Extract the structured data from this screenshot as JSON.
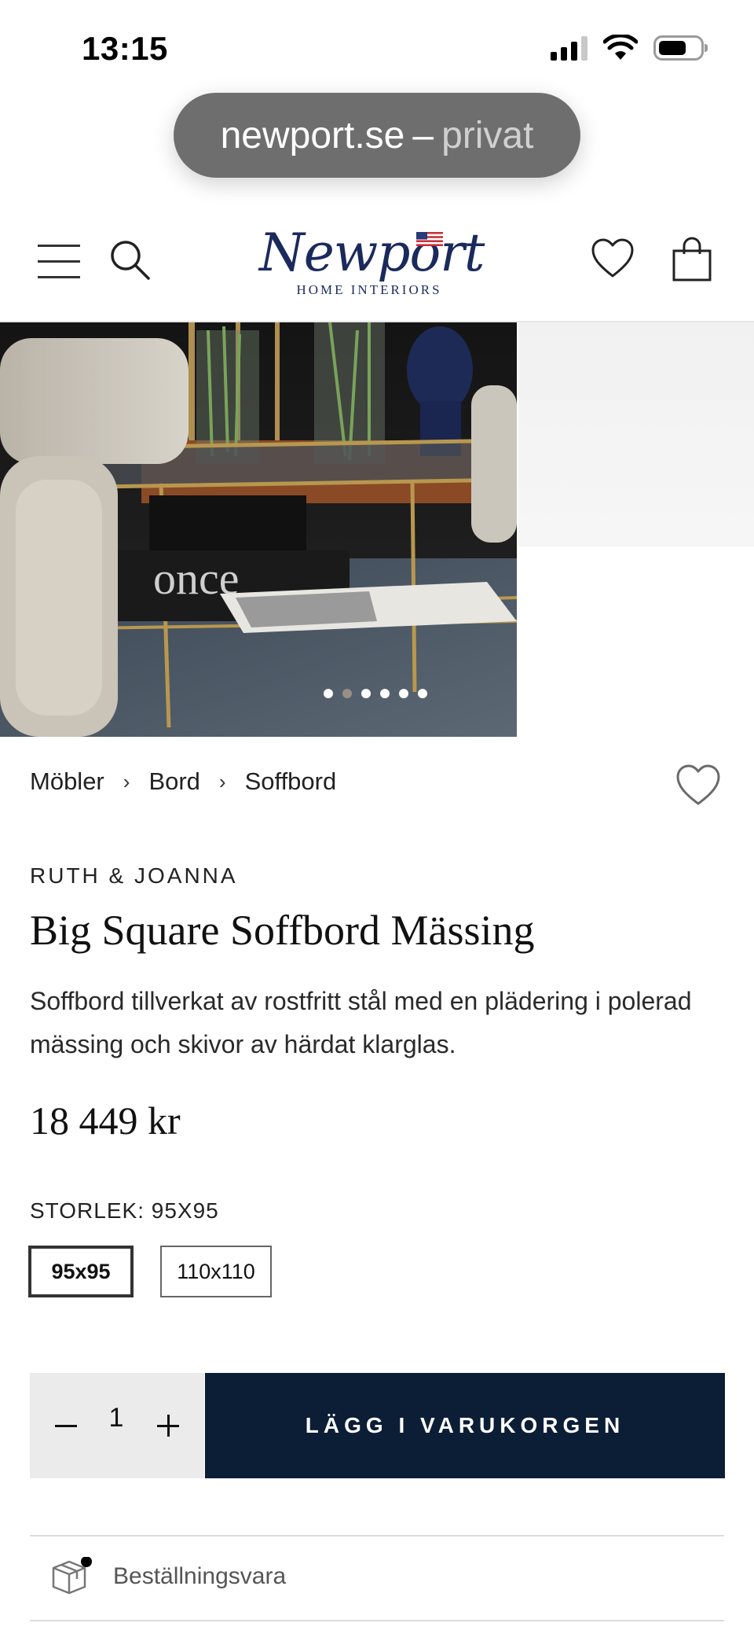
{
  "status_bar": {
    "time": "13:15"
  },
  "browser": {
    "domain": "newport.se",
    "separator": "–",
    "mode": "privat"
  },
  "header": {
    "logo_script": "Newport",
    "logo_sub": "HOME INTERIORS",
    "icons": [
      "menu-icon",
      "search-icon",
      "heart-icon",
      "shopping-bag-icon"
    ]
  },
  "gallery": {
    "dot_count": 6,
    "active_dot": 1
  },
  "breadcrumb": {
    "items": [
      "Möbler",
      "Bord",
      "Soffbord"
    ],
    "separator": "›"
  },
  "product": {
    "brand": "RUTH & JOANNA",
    "title": "Big Square Soffbord Mässing",
    "description": "Soffbord tillverkat av rostfritt stål med en plädering i polerad mässing och skivor av härdat klarglas.",
    "price": "18 449 kr"
  },
  "size": {
    "label": "STORLEK: 95X95",
    "options": [
      "95x95",
      "110x110"
    ],
    "selected": "95x95"
  },
  "cart": {
    "quantity": "1",
    "add_label": "LÄGG I VARUKORGEN"
  },
  "stock": {
    "label": "Beställningsvara"
  },
  "colors": {
    "brand_navy": "#0c1d36",
    "logo_blue": "#1b2a5c"
  }
}
